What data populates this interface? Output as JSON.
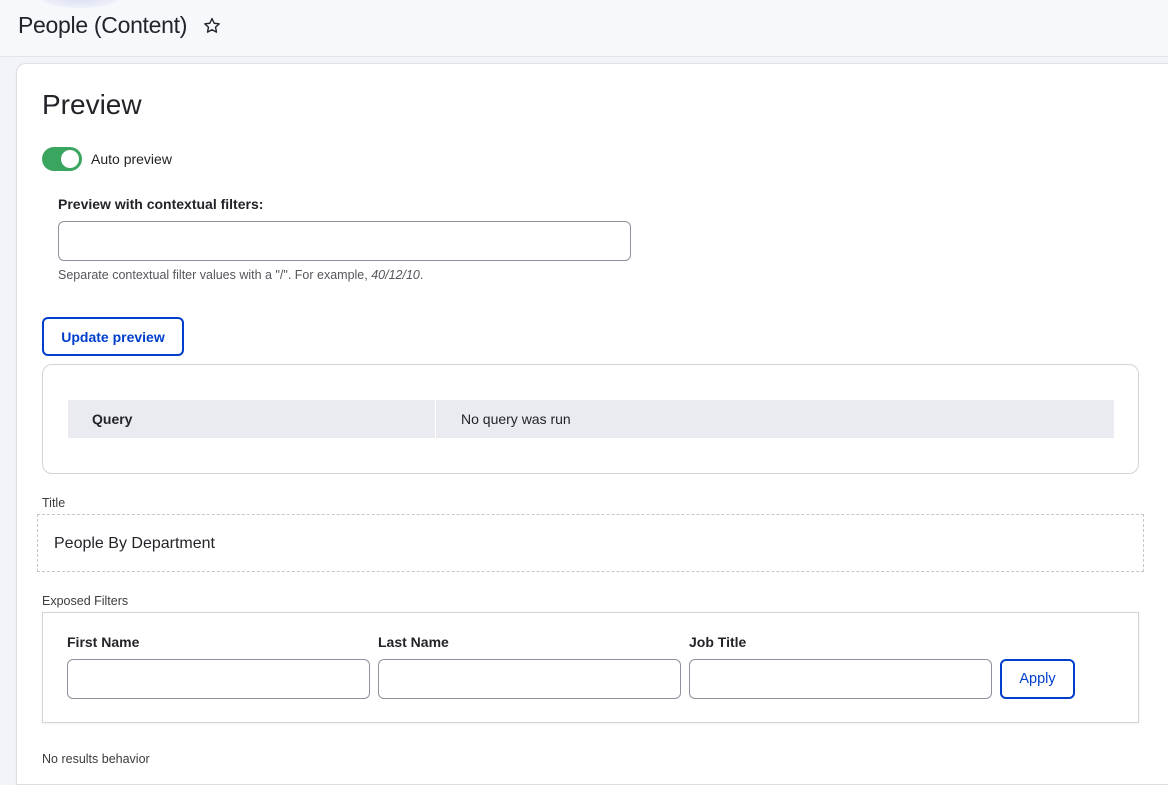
{
  "header": {
    "title": "People (Content)",
    "favorite_icon": "star-outline-icon"
  },
  "preview": {
    "heading": "Preview",
    "auto_preview": {
      "label": "Auto preview",
      "checked": true,
      "color": "#3aa55e"
    },
    "contextual": {
      "label": "Preview with contextual filters:",
      "value": "",
      "placeholder": "",
      "help_prefix": "Separate contextual filter values with a \"/\". For example, ",
      "help_example": "40/12/10",
      "help_suffix": "."
    },
    "update_button": "Update preview",
    "query": {
      "key": "Query",
      "value": "No query was run"
    }
  },
  "title_section": {
    "label": "Title",
    "value": "People By Department"
  },
  "exposed_filters": {
    "label": "Exposed Filters",
    "fields": [
      {
        "label": "First Name",
        "value": ""
      },
      {
        "label": "Last Name",
        "value": ""
      },
      {
        "label": "Job Title",
        "value": ""
      }
    ],
    "apply_button": "Apply"
  },
  "no_results": {
    "label": "No results behavior"
  },
  "colors": {
    "accent": "#003ecc",
    "toggle_on": "#3aa55e"
  }
}
